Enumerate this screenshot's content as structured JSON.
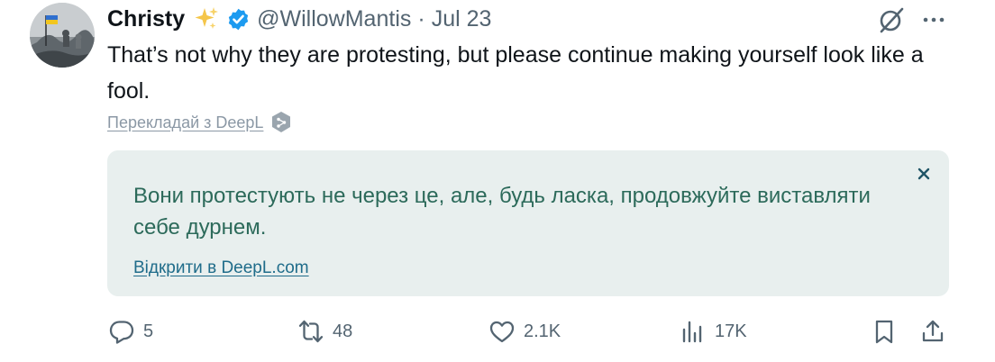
{
  "tweet": {
    "author": {
      "name": "Christy",
      "handle": "@WillowMantis",
      "separator": "·",
      "date": "Jul 23",
      "verified_color": "#1d9bf0"
    },
    "text": "That’s not why they are protesting, but please continue making yourself look like a fool.",
    "translate_link": "Перекладай з DeepL",
    "translation": {
      "text": "Вони протестують не через це, але, будь ласка, продовжуйте виставляти себе дурнем.",
      "open_link": "Відкрити в DeepL.com",
      "background": "#e8efee",
      "text_color": "#2c6a5a"
    },
    "actions": {
      "replies": "5",
      "reposts": "48",
      "likes": "2.1K",
      "views": "17K"
    }
  },
  "icons": [
    "sparkle-icon",
    "verified-badge-icon",
    "grok-icon",
    "more-icon",
    "deepl-icon",
    "close-icon",
    "reply-icon",
    "repost-icon",
    "like-icon",
    "views-icon",
    "bookmark-icon",
    "share-icon"
  ]
}
